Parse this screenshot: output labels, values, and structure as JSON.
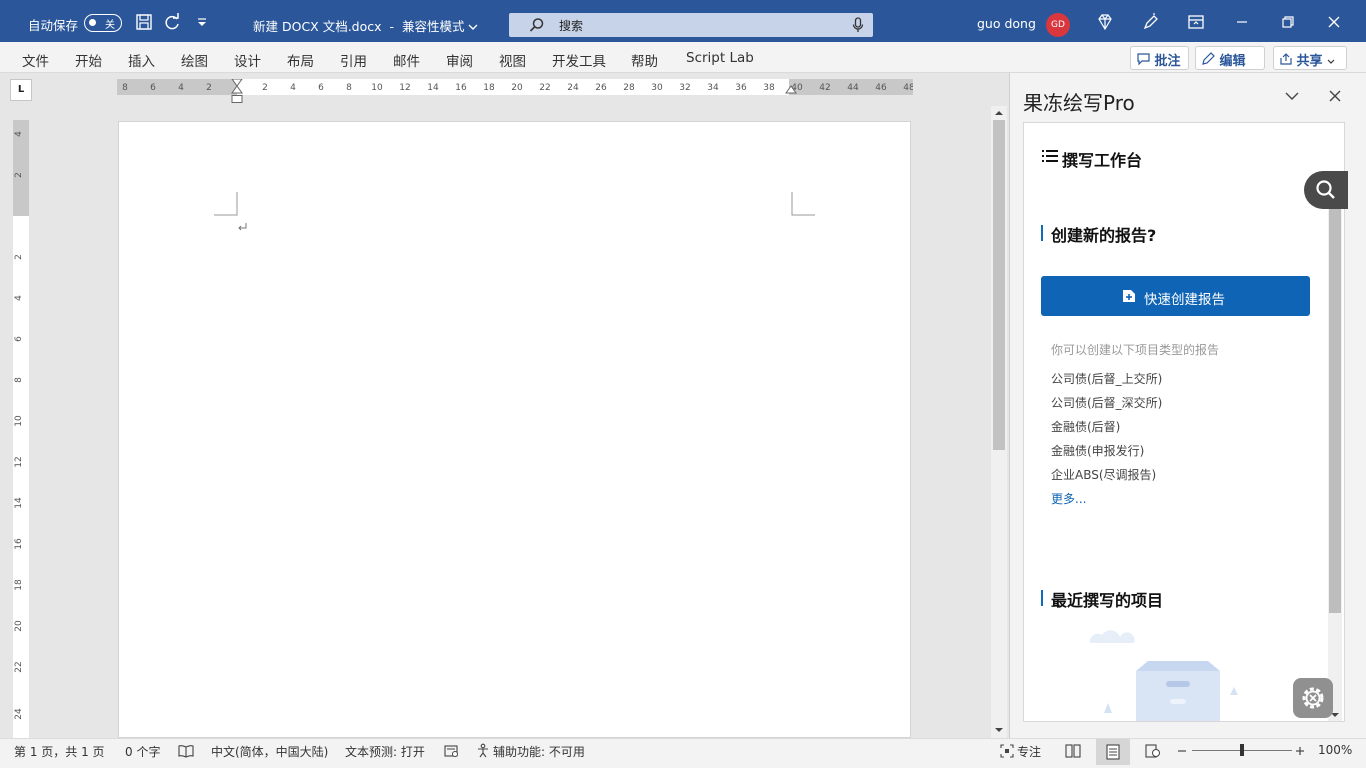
{
  "titlebar": {
    "autosave_label": "自动保存",
    "autosave_state": "关",
    "document_name": "新建 DOCX 文档.docx",
    "separator": "-",
    "mode": "兼容性模式",
    "search_placeholder": "搜索",
    "user_name": "guo dong",
    "avatar_initials": "GD"
  },
  "ribbon": {
    "tabs": [
      "文件",
      "开始",
      "插入",
      "绘图",
      "设计",
      "布局",
      "引用",
      "邮件",
      "审阅",
      "视图",
      "开发工具",
      "帮助",
      "Script Lab"
    ],
    "comments_label": "批注",
    "editing_label": "编辑",
    "share_label": "共享"
  },
  "ruler": {
    "corner_label": "L",
    "h_ticks": [
      "8",
      "6",
      "4",
      "2",
      "2",
      "4",
      "6",
      "8",
      "10",
      "12",
      "14",
      "16",
      "18",
      "20",
      "22",
      "24",
      "26",
      "28",
      "30",
      "32",
      "34",
      "36",
      "38",
      "40",
      "42",
      "44",
      "46",
      "48"
    ],
    "v_ticks": [
      "4",
      "2",
      "2",
      "4",
      "6",
      "8",
      "10",
      "12",
      "14",
      "16",
      "18",
      "20",
      "22",
      "24"
    ]
  },
  "pane": {
    "title": "果冻绘写Pro",
    "workbench_title": "撰写工作台",
    "create_section_title": "创建新的报告?",
    "create_button_label": "快速创建报告",
    "hint": "你可以创建以下项目类型的报告",
    "report_types": [
      "公司债(后督_上交所)",
      "公司债(后督_深交所)",
      "金融债(后督)",
      "金融债(申报发行)",
      "企业ABS(尽调报告)"
    ],
    "more_label": "更多...",
    "recent_section_title": "最近撰写的项目"
  },
  "status": {
    "page_info": "第 1 页，共 1 页",
    "word_count": "0 个字",
    "language": "中文(简体，中国大陆)",
    "text_prediction": "文本预测: 打开",
    "accessibility": "辅助功能: 不可用",
    "focus_label": "专注",
    "zoom": "100%"
  },
  "colors": {
    "titlebar": "#2b579a",
    "accent": "#0f64b5",
    "avatar": "#d9363e"
  }
}
